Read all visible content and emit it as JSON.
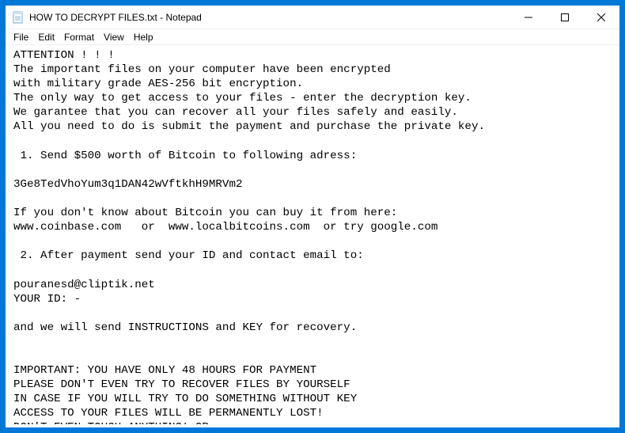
{
  "titlebar": {
    "title": "HOW TO DECRYPT FILES.txt - Notepad"
  },
  "menubar": {
    "file": "File",
    "edit": "Edit",
    "format": "Format",
    "view": "View",
    "help": "Help"
  },
  "content": {
    "body": "ATTENTION ! ! !\nThe important files on your computer have been encrypted\nwith military grade AES-256 bit encryption.\nThe only way to get access to your files - enter the decryption key.\nWe garantee that you can recover all your files safely and easily.\nAll you need to do is submit the payment and purchase the private key.\n\n 1. Send $500 worth of Bitcoin to following adress:\n\n3Ge8TedVhoYum3q1DAN42wVftkhH9MRVm2\n\nIf you don't know about Bitcoin you can buy it from here:\nwww.coinbase.com   or  www.localbitcoins.com  or try google.com\n\n 2. After payment send your ID and contact email to:\n\npouranesd@cliptik.net\nYOUR ID: -\n\nand we will send INSTRUCTIONS and KEY for recovery.\n\n\nIMPORTANT: YOU HAVE ONLY 48 HOURS FOR PAYMENT\nPLEASE DON'T EVEN TRY TO RECOVER FILES BY YOURSELF\nIN CASE IF YOU WILL TRY TO DO SOMETHING WITHOUT KEY\nACCESS TO YOUR FILES WILL BE PERMANENTLY LOST!\nDON'T EVEN TOUCH ANYTHING! OR\nACCESS TO YOUR FILES WILL BE PERMANENTLY LOST!"
  }
}
